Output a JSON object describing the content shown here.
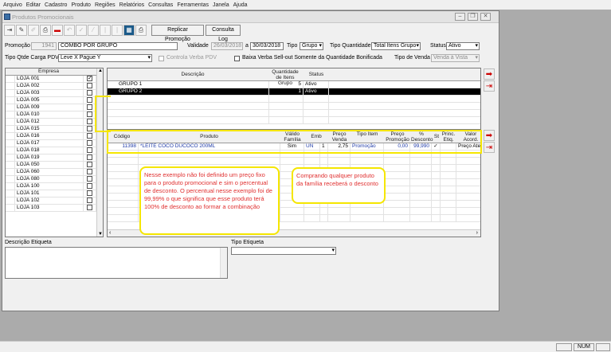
{
  "menu": [
    "Arquivo",
    "Editar",
    "Cadastro",
    "Produto",
    "Regiões",
    "Relatórios",
    "Consultas",
    "Ferramentas",
    "Janela",
    "Ajuda"
  ],
  "window": {
    "title": "Produtos Promocionais"
  },
  "toolbar": {
    "replicar": "Replicar Promoção",
    "consulta_log": "Consulta Log"
  },
  "form": {
    "promocao_label": "Promoção",
    "promocao_id": "1941",
    "promocao_nome": "COMBO POR GRUPO",
    "validade_label": "Validade",
    "validade_inicio": "26/03/2018",
    "validade_sep": "a",
    "validade_fim": "30/03/2018",
    "tipo_label": "Tipo",
    "tipo_value": "Grupo",
    "tipo_qtd_label": "Tipo Quantidade",
    "tipo_qtd_value": "Total Itens Grupo",
    "status_label": "Status",
    "status_value": "Ativo",
    "tipo_qtde_carga_label": "Tipo Qtde Carga PDV",
    "tipo_qtde_carga_value": "Leve X Pague Y",
    "controla_verba_label": "Controla Verba PDV",
    "baixa_verba_label": "Baixa Verba Sell-out Somente da Quantidade Bonificada",
    "tipo_venda_label": "Tipo de Venda",
    "tipo_venda_value": "Venda à Vista"
  },
  "empresa": {
    "header": "Empresa",
    "items": [
      {
        "name": "LOJA 001",
        "checked": "✓"
      },
      {
        "name": "LOJA 002",
        "checked": ""
      },
      {
        "name": "LOJA 003",
        "checked": ""
      },
      {
        "name": "LOJA 005",
        "checked": ""
      },
      {
        "name": "LOJA 009",
        "checked": ""
      },
      {
        "name": "LOJA 010",
        "checked": ""
      },
      {
        "name": "LOJA 012",
        "checked": ""
      },
      {
        "name": "LOJA 015",
        "checked": ""
      },
      {
        "name": "LOJA 016",
        "checked": ""
      },
      {
        "name": "LOJA 017",
        "checked": ""
      },
      {
        "name": "LOJA 018",
        "checked": ""
      },
      {
        "name": "LOJA 019",
        "checked": ""
      },
      {
        "name": "LOJA 050",
        "checked": ""
      },
      {
        "name": "LOJA 060",
        "checked": ""
      },
      {
        "name": "LOJA 080",
        "checked": ""
      },
      {
        "name": "LOJA 100",
        "checked": ""
      },
      {
        "name": "LOJA 101",
        "checked": ""
      },
      {
        "name": "LOJA 102",
        "checked": ""
      },
      {
        "name": "LOJA 103",
        "checked": ""
      }
    ]
  },
  "grupos": {
    "headers": {
      "descricao": "Descrição",
      "quantidade": "Quantidade de Itens Grupo",
      "status": "Status"
    },
    "rows": [
      {
        "descricao": "GRUPO 1",
        "quantidade": "5",
        "status": "Ativo"
      },
      {
        "descricao": "GRUPO 2",
        "quantidade": "1",
        "status": "Ativo"
      }
    ]
  },
  "produtos": {
    "headers": {
      "codigo": "Código",
      "produto": "Produto",
      "valido": "Válido Família",
      "emb": "Emb",
      "preco_venda": "Preço Venda",
      "tipo_item": "Tipo Item",
      "preco_promo": "Preço Promoção",
      "desconto": "% Desconto",
      "st": "St",
      "princ": "Princ. Etiq.",
      "valor": "Valor Acord."
    },
    "rows": [
      {
        "codigo": "11398",
        "produto": "*LEITE COCO DUCOCO 200ML",
        "valido": "Sim",
        "emb": "UN",
        "qtd": "1",
        "preco_venda": "2,75",
        "tipo_item": "Promoção",
        "preco_promo": "0,00",
        "desconto": "99,990",
        "st": "✓",
        "princ": "",
        "valor": "Preço Ate"
      }
    ]
  },
  "notes": {
    "left": "Nesse exemplo não foi definido um preço fixo para o produto promocional e sim o percentual de desconto. O percentual nesse exemplo foi de 99,99% o que significa que esse produto terá 100% de desconto ao formar a combinação",
    "right": "Comprando qualquer produto da família receberá o desconto"
  },
  "bottom": {
    "descricao_etiqueta_label": "Descrição Etiqueta",
    "tipo_etiqueta_label": "Tipo Etiqueta"
  },
  "status": {
    "num": "NUM"
  },
  "colors": {
    "highlight": "#f5e600",
    "note_text": "#e03030",
    "selected_row": "#000000"
  }
}
